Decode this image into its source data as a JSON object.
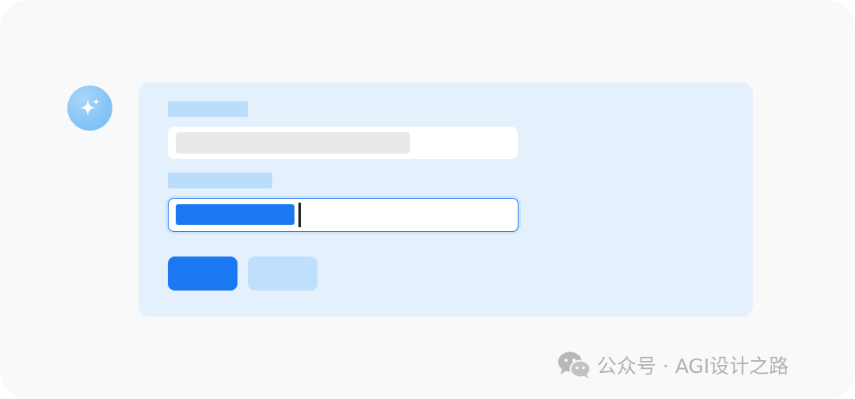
{
  "assistant": {
    "icon": "sparkle-icon",
    "color": "#86c4f6"
  },
  "form": {
    "fields": [
      {
        "state": "default",
        "value": ""
      },
      {
        "state": "focused",
        "value": "",
        "focus_color": "#1a78f0"
      }
    ],
    "buttons": [
      {
        "role": "primary",
        "label": "",
        "color": "#1978f2"
      },
      {
        "role": "secondary",
        "label": "",
        "color": "#bee0fc"
      }
    ]
  },
  "watermark": {
    "icon": "wechat-icon",
    "text": "公众号 · AGI设计之路"
  }
}
